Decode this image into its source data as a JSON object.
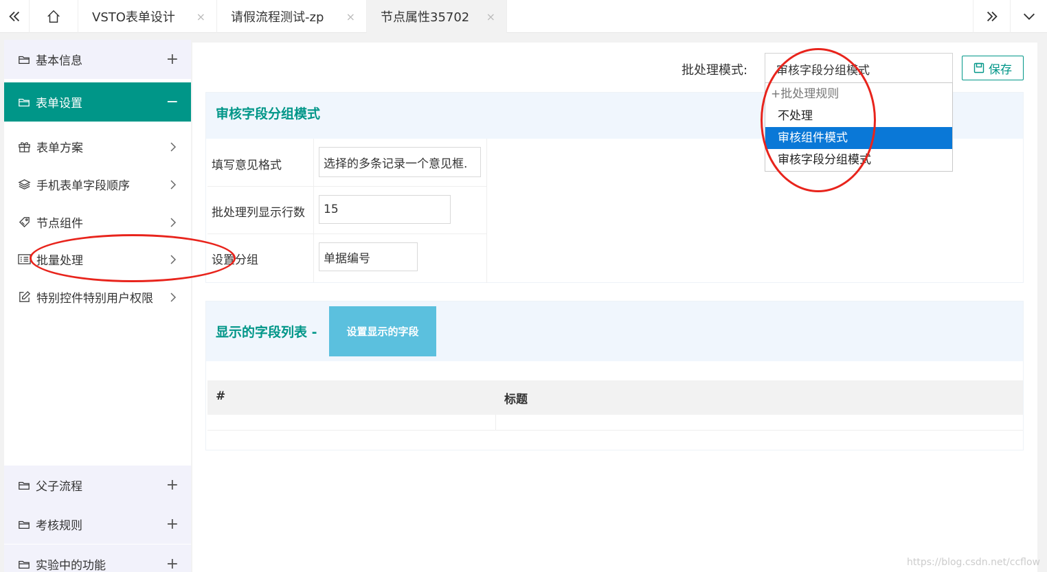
{
  "tabbar": {
    "back_icon": "double-chevron-left-icon",
    "home_icon": "home-icon",
    "tabs": [
      {
        "label": "VSTO表单设计",
        "close": "×"
      },
      {
        "label": "请假流程测试-zp",
        "close": "×"
      },
      {
        "label": "节点属性35702",
        "close": "×"
      }
    ],
    "forward_icon": "double-chevron-right-icon",
    "more_icon": "chevron-down-icon"
  },
  "sidebar": {
    "groups_top": [
      {
        "label": "基本信息",
        "sign": "+"
      },
      {
        "label": "表单设置",
        "sign": "−"
      }
    ],
    "items": [
      {
        "label": "表单方案",
        "icon": "gift-icon"
      },
      {
        "label": "手机表单字段顺序",
        "icon": "layers-icon"
      },
      {
        "label": "节点组件",
        "icon": "tag-icon"
      },
      {
        "label": "批量处理",
        "icon": "keyboard-icon"
      },
      {
        "label": "特别控件特别用户权限",
        "icon": "edit-icon"
      }
    ],
    "groups_bottom": [
      {
        "label": "父子流程",
        "sign": "+"
      },
      {
        "label": "考核规则",
        "sign": "+"
      },
      {
        "label": "实验中的功能",
        "sign": "+"
      }
    ]
  },
  "main": {
    "mode_label": "批处理模式:",
    "mode_value": "审核字段分组模式",
    "save_label": "保存",
    "dropdown": {
      "group_label": "+批处理规则",
      "options": [
        "不处理",
        "审核组件模式",
        "审核字段分组模式"
      ],
      "selected_index": 1
    },
    "section1": {
      "title": "审核字段分组模式",
      "fields": [
        {
          "label": "填写意见格式",
          "value": "选择的多条记录一个意见框."
        },
        {
          "label": "批处理列显示行数",
          "value": "15"
        },
        {
          "label": "设置分组",
          "value": "单据编号"
        }
      ]
    },
    "section2": {
      "title": "显示的字段列表 -",
      "button_label": "设置显示的字段",
      "columns": [
        "#",
        "标题"
      ]
    }
  },
  "watermark": "https://blog.csdn.net/ccflow",
  "colors": {
    "accent": "#009688",
    "selected": "#0a78d7",
    "annotation": "#e8241c",
    "info_button": "#5bc0de"
  }
}
